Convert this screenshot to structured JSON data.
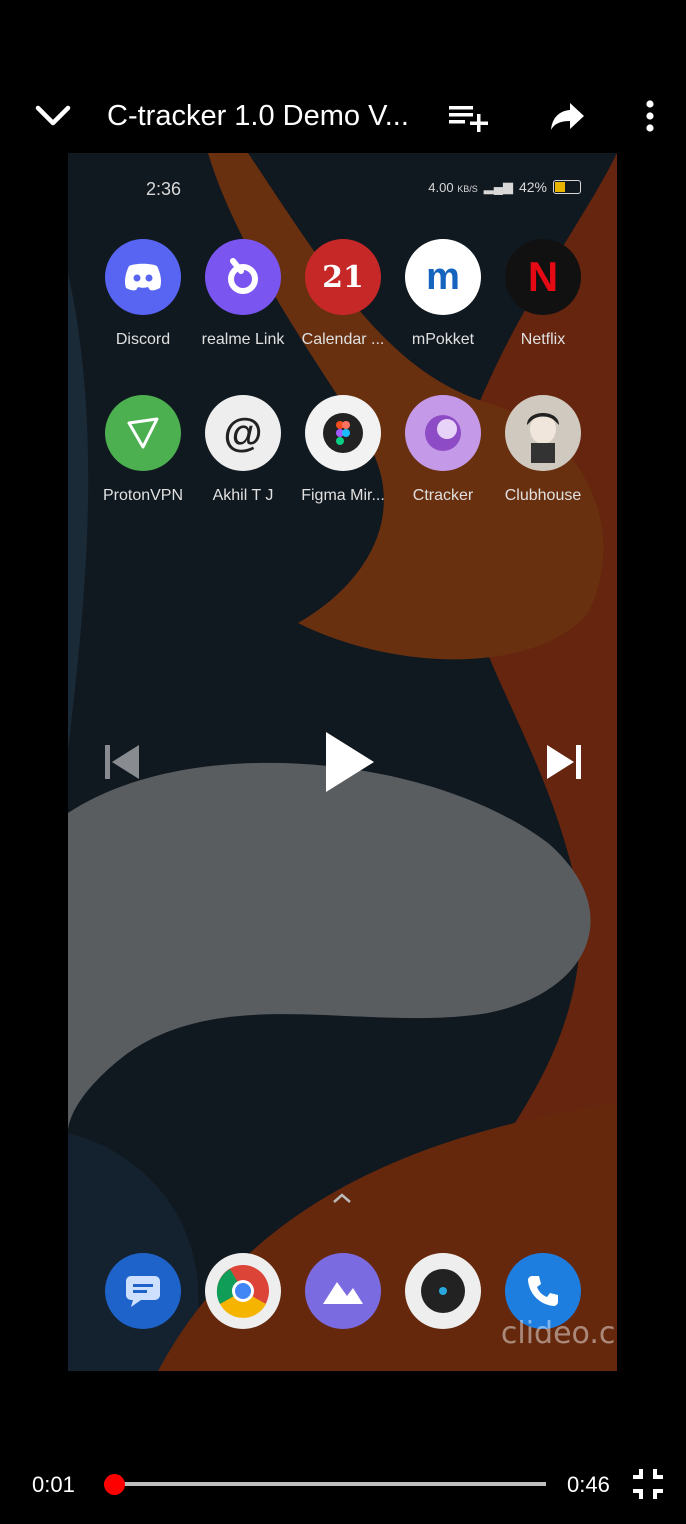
{
  "player": {
    "title": "C-tracker 1.0 Demo V...",
    "current_time": "0:01",
    "duration": "0:46",
    "progress_fraction": 0.022,
    "accent_color": "#ff0000",
    "icons": {
      "collapse": "chevron-down-icon",
      "add_to_queue": "playlist-add-icon",
      "share": "share-icon",
      "more": "more-vert-icon",
      "previous": "skip-previous-icon",
      "play": "play-icon",
      "next": "skip-next-icon",
      "exit_fullscreen": "fullscreen-exit-icon"
    }
  },
  "video_frame": {
    "status_time": "2:36",
    "status_speed": "4.00",
    "status_speed_unit": "KB/S",
    "battery": "42%",
    "apps_row1": [
      {
        "label": "Discord",
        "glyph": "",
        "color": "#5865f2"
      },
      {
        "label": "realme Link",
        "glyph": "",
        "color": "#7b55f0"
      },
      {
        "label": "Calendar ...",
        "glyph": "21",
        "color": "#c62828"
      },
      {
        "label": "mPokket",
        "glyph": "m",
        "color": "#ffffff"
      },
      {
        "label": "Netflix",
        "glyph": "N",
        "color": "#111111"
      }
    ],
    "apps_row2": [
      {
        "label": "ProtonVPN",
        "glyph": "",
        "color": "#4caf50"
      },
      {
        "label": "Akhil T J",
        "glyph": "@",
        "color": "#eeeeee"
      },
      {
        "label": "Figma Mir...",
        "glyph": "",
        "color": "#f2f2f2"
      },
      {
        "label": "Ctracker",
        "glyph": "",
        "color": "#b38bd9"
      },
      {
        "label": "Clubhouse",
        "glyph": "",
        "color": "#cfc9c0"
      }
    ],
    "dock": [
      "messages-icon",
      "chrome-icon",
      "gallery-icon",
      "camera-icon",
      "phone-icon"
    ],
    "watermark": "clideo.com"
  }
}
